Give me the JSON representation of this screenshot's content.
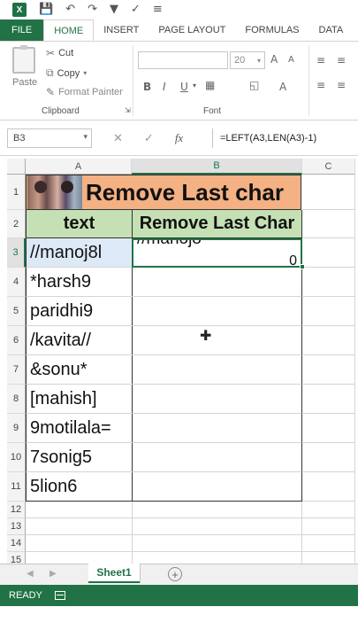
{
  "qat": {
    "app_icon": "X",
    "icons": [
      "save-icon",
      "undo-icon",
      "redo-icon",
      "filter-icon",
      "spelling-icon",
      "customize-icon"
    ]
  },
  "tabs": [
    "FILE",
    "HOME",
    "INSERT",
    "PAGE LAYOUT",
    "FORMULAS",
    "DATA"
  ],
  "active_tab": "HOME",
  "ribbon": {
    "paste_label": "Paste",
    "cut_label": "Cut",
    "copy_label": "Copy",
    "format_painter_label": "Format Painter",
    "clipboard_group": "Clipboard",
    "font_size": "20",
    "font_group": "Font",
    "bold": "B",
    "italic": "I",
    "underline": "U",
    "grow_font": "A",
    "shrink_font": "A"
  },
  "formula_bar": {
    "name_box": "B3",
    "cancel": "✕",
    "confirm": "✓",
    "fx": "fx",
    "formula": "=LEFT(A3,LEN(A3)-1)"
  },
  "columns": [
    "A",
    "B",
    "C"
  ],
  "rows": [
    "1",
    "2",
    "3",
    "4",
    "5",
    "6",
    "7",
    "8",
    "9",
    "10",
    "11",
    "12",
    "13",
    "14",
    "15"
  ],
  "sheet": {
    "title": "Remove Last char",
    "header_a": "text",
    "header_b": "Remove Last Char",
    "active_cell_clipped": "//manoj8",
    "active_cell_trail": "0",
    "values": [
      "//manoj8l",
      "*harsh9",
      "paridhi9",
      "/kavita//",
      "&sonu*",
      "[mahish]",
      "9motilala=",
      "7sonig5",
      "5lion6"
    ]
  },
  "sheet_tab": "Sheet1",
  "status": "READY",
  "colors": {
    "accent": "#217346",
    "title_fill": "#f4b183",
    "header_fill": "#c5e0b4"
  }
}
